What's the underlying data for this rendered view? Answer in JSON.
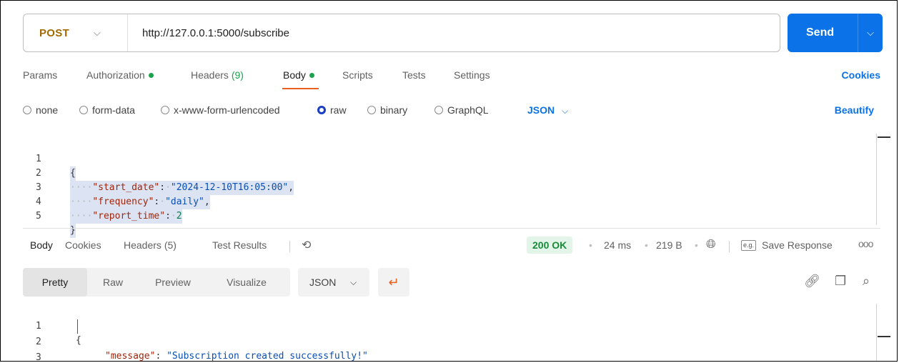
{
  "request": {
    "method": "POST",
    "url": "http://127.0.0.1:5000/subscribe",
    "send_label": "Send",
    "tabs": [
      {
        "label": "Params"
      },
      {
        "label": "Authorization"
      },
      {
        "label": "Headers",
        "count": "(9)"
      },
      {
        "label": "Body"
      },
      {
        "label": "Scripts"
      },
      {
        "label": "Tests"
      },
      {
        "label": "Settings"
      }
    ],
    "cookies_label": "Cookies",
    "body_types": [
      "none",
      "form-data",
      "x-www-form-urlencoded",
      "raw",
      "binary",
      "GraphQL"
    ],
    "body_format": "JSON",
    "beautify_label": "Beautify",
    "code_lines": [
      {
        "n": "1",
        "text": "{"
      },
      {
        "n": "2",
        "key": "\"start_date\"",
        "value": "\"2024-12-10T16:05:00\"",
        "trail": ","
      },
      {
        "n": "3",
        "key": "\"frequency\"",
        "value": "\"daily\"",
        "trail": ","
      },
      {
        "n": "4",
        "key": "\"report_time\"",
        "value": "2",
        "trail": ""
      },
      {
        "n": "5",
        "text": "}"
      }
    ]
  },
  "response": {
    "tabs": [
      {
        "label": "Body"
      },
      {
        "label": "Cookies"
      },
      {
        "label": "Headers",
        "count": "(5)"
      },
      {
        "label": "Test Results"
      }
    ],
    "status": "200 OK",
    "time": "24 ms",
    "size": "219 B",
    "save_label": "Save Response",
    "more_label": "ooo",
    "eg_label": "e.g.",
    "view_modes": [
      "Pretty",
      "Raw",
      "Preview",
      "Visualize"
    ],
    "format": "JSON",
    "code_lines": [
      {
        "n": "1",
        "text": "{"
      },
      {
        "n": "2",
        "key": "\"message\"",
        "value": "\"Subscription created successfully!\""
      },
      {
        "n": "3",
        "text": "}"
      }
    ]
  },
  "colors": {
    "accent": "#0b72e7",
    "method": "#a16a00",
    "success": "#1aa34a",
    "active_tab_underline": "#e8601c"
  },
  "icons": [
    "chevron-down-icon",
    "history-icon",
    "globe-icon",
    "link-icon",
    "copy-icon",
    "search-icon",
    "wrap-lines-icon"
  ]
}
